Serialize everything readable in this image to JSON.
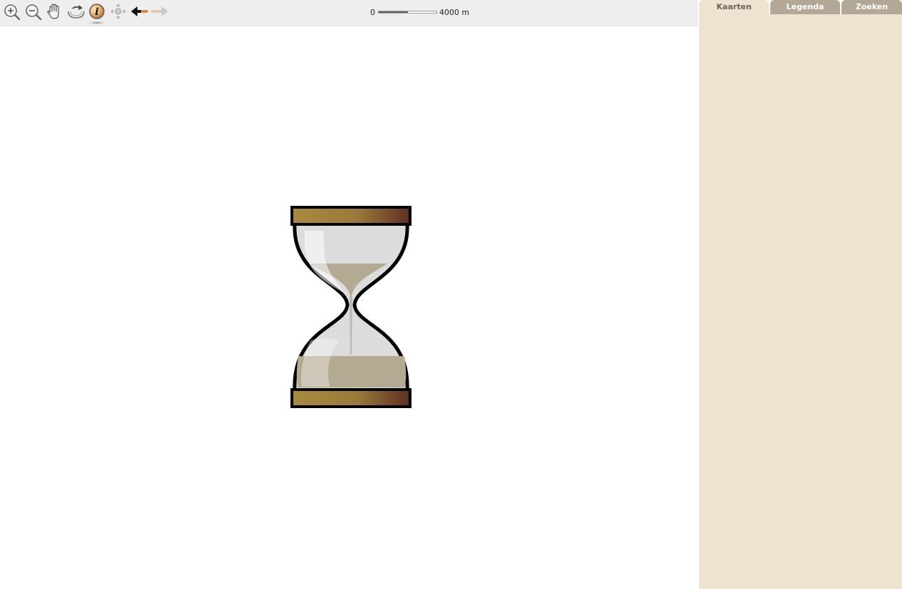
{
  "toolbar": {
    "tools": [
      {
        "name": "zoom-in-icon"
      },
      {
        "name": "zoom-out-icon"
      },
      {
        "name": "pan-hand-icon"
      },
      {
        "name": "refresh-map-icon"
      },
      {
        "name": "info-icon",
        "active": true
      },
      {
        "name": "full-extent-icon"
      },
      {
        "name": "back-arrow-icon"
      },
      {
        "name": "forward-arrow-icon",
        "disabled": true
      }
    ]
  },
  "scale": {
    "start_label": "0",
    "end_label": "4000 m"
  },
  "loading": {
    "indicator": "hourglass-icon"
  },
  "panel": {
    "tabs": [
      {
        "label": "Kaarten",
        "active": true
      },
      {
        "label": "Legenda",
        "active": false
      },
      {
        "label": "Zoeken",
        "active": false
      }
    ]
  },
  "colors": {
    "toolbar_bg": "#eeeeee",
    "panel_bg": "#ede3d0",
    "inactive_tab_bg": "#b3a795",
    "active_tab_text": "#6e6355"
  }
}
